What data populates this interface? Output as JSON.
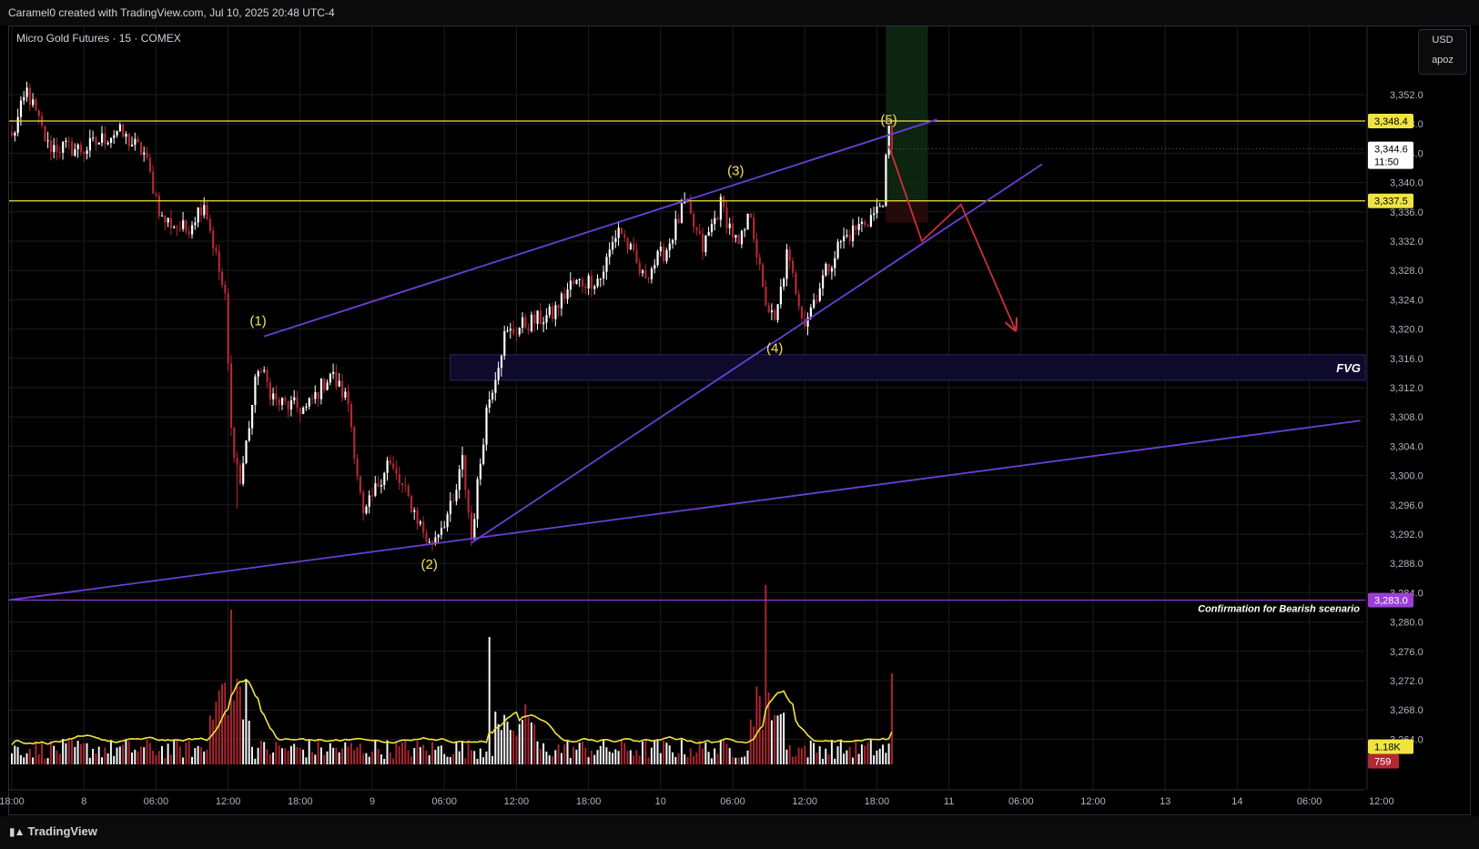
{
  "header": {
    "text": "Caramel0 created with TradingView.com, Jul 10, 2025 20:48 UTC-4"
  },
  "symbol": {
    "text": "Micro Gold Futures · 15 · COMEX"
  },
  "currency": {
    "code": "USD",
    "user": "apoz"
  },
  "footer": {
    "brand": "TradingView",
    "logo": "tradingview-logo-icon"
  },
  "colors": {
    "background": "#000000",
    "up": "#ffffff",
    "down": "#b22833",
    "grid": "#1c1c1c",
    "level": "#f0e442",
    "channel": "#6a3fd6",
    "arrow": "#cc2f3a",
    "label": "#f5e55b"
  },
  "chart_data": {
    "type": "candlestick",
    "title": "",
    "price_axis": {
      "ylim": [
        3260,
        3356
      ],
      "ticks": [
        "3,352.0",
        "3,348.0",
        "3,344.0",
        "3,340.0",
        "3,336.0",
        "3,332.0",
        "3,328.0",
        "3,324.0",
        "3,320.0",
        "3,316.0",
        "3,312.0",
        "3,308.0",
        "3,304.0",
        "3,300.0",
        "3,296.0",
        "3,292.0",
        "3,288.0",
        "3,284.0",
        "3,280.0",
        "3,276.0",
        "3,272.0",
        "3,268.0",
        "3,264.0"
      ],
      "tick_values": [
        3352,
        3348,
        3344,
        3340,
        3336,
        3332,
        3328,
        3324,
        3320,
        3316,
        3312,
        3308,
        3304,
        3300,
        3296,
        3292,
        3288,
        3284,
        3280,
        3276,
        3272,
        3268,
        3264
      ]
    },
    "time_axis": {
      "labels": [
        "18:00",
        "8",
        "06:00",
        "12:00",
        "18:00",
        "9",
        "06:00",
        "12:00",
        "18:00",
        "10",
        "06:00",
        "12:00",
        "18:00",
        "11",
        "06:00",
        "12:00",
        "13",
        "14",
        "06:00",
        "12:00"
      ],
      "bar_index": [
        0,
        24,
        48,
        72,
        96,
        120,
        144,
        168,
        192,
        216,
        240,
        264,
        288,
        312,
        336,
        360,
        384,
        408,
        432,
        456
      ]
    },
    "price_tags": [
      {
        "label": "3,348.4",
        "value": 3348.4,
        "style": "yellow"
      },
      {
        "label": "3,344.6",
        "value": 3344.6,
        "sub": "11:50",
        "style": "white"
      },
      {
        "label": "3,337.5",
        "value": 3337.5,
        "style": "yellow"
      },
      {
        "label": "3,283.0",
        "value": 3283.0,
        "style": "purple"
      },
      {
        "label": "1.18K",
        "value": 3263.0,
        "style": "yellow"
      },
      {
        "label": "759",
        "value": 3261.0,
        "style": "red"
      }
    ],
    "horizontal_levels": [
      {
        "value": 3348.4,
        "color": "yellow"
      },
      {
        "value": 3337.5,
        "color": "yellow"
      },
      {
        "value": 3283.0,
        "color": "purple",
        "note": "Confirmation for Bearish scenario"
      }
    ],
    "fvg_zone": {
      "label": "FVG",
      "low": 3313.0,
      "high": 3316.5,
      "from_bar": 146
    },
    "wave_labels": [
      {
        "text": "(1)",
        "bar": 82,
        "price": 3319.0
      },
      {
        "text": "(2)",
        "bar": 139,
        "price": 3290.0
      },
      {
        "text": "(3)",
        "bar": 241,
        "price": 3339.5
      },
      {
        "text": "(4)",
        "bar": 254,
        "price": 3319.5
      },
      {
        "text": "(5)",
        "bar": 292,
        "price": 3346.5
      }
    ],
    "channel_lines": [
      {
        "from": [
          84,
          3319.0
        ],
        "to": [
          308,
          3348.6
        ]
      },
      {
        "from": [
          153,
          3290.8
        ],
        "to": [
          343,
          3342.5
        ]
      },
      {
        "from": [
          -1,
          3283.0
        ],
        "to": [
          449,
          3307.5
        ]
      }
    ],
    "projection_path": [
      [
        292,
        3345.0
      ],
      [
        303,
        3332.0
      ],
      [
        316,
        3337.0
      ],
      [
        334,
        3320.0
      ]
    ],
    "series": [
      {
        "name": "price",
        "volume_ma_color": "#f0e442",
        "anchors": [
          [
            0,
            3346.0
          ],
          [
            5,
            3352.5
          ],
          [
            12,
            3345.0
          ],
          [
            24,
            3344.5
          ],
          [
            35,
            3347.0
          ],
          [
            44,
            3344.0
          ],
          [
            50,
            3335.0
          ],
          [
            58,
            3333.5
          ],
          [
            64,
            3337.5
          ],
          [
            71,
            3324.0
          ],
          [
            73,
            3306.0
          ],
          [
            76,
            3299.0
          ],
          [
            82,
            3315.0
          ],
          [
            88,
            3310.0
          ],
          [
            98,
            3309.0
          ],
          [
            106,
            3314.0
          ],
          [
            112,
            3310.0
          ],
          [
            117,
            3294.0
          ],
          [
            125,
            3302.0
          ],
          [
            133,
            3296.0
          ],
          [
            139,
            3290.5
          ],
          [
            147,
            3296.0
          ],
          [
            150,
            3302.0
          ],
          [
            153,
            3291.5
          ],
          [
            158,
            3309.0
          ],
          [
            164,
            3319.0
          ],
          [
            170,
            3320.5
          ],
          [
            180,
            3322.0
          ],
          [
            186,
            3326.0
          ],
          [
            196,
            3327.0
          ],
          [
            202,
            3334.0
          ],
          [
            210,
            3327.0
          ],
          [
            218,
            3331.0
          ],
          [
            224,
            3337.0
          ],
          [
            230,
            3331.0
          ],
          [
            236,
            3337.0
          ],
          [
            242,
            3331.0
          ],
          [
            246,
            3336.0
          ],
          [
            250,
            3325.0
          ],
          [
            254,
            3320.5
          ],
          [
            258,
            3330.0
          ],
          [
            264,
            3321.0
          ],
          [
            270,
            3327.0
          ],
          [
            276,
            3332.0
          ],
          [
            282,
            3334.0
          ],
          [
            288,
            3336.0
          ],
          [
            290,
            3338.0
          ],
          [
            292,
            3347.0
          ],
          [
            293,
            3344.6
          ]
        ]
      }
    ]
  }
}
